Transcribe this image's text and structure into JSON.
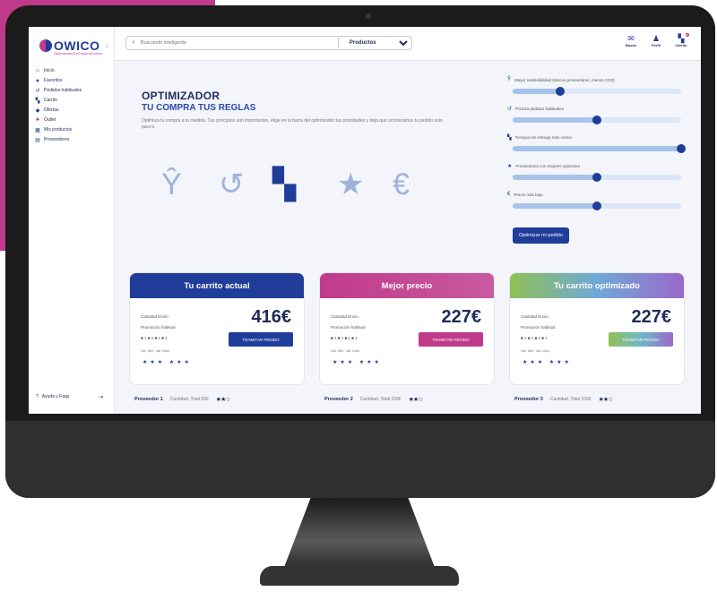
{
  "brand": {
    "name": "OWICO",
    "tagline": "OptimizadorDeComprasOnline",
    "magenta": "#c03a8b",
    "navy": "#1f3d99"
  },
  "sidebar": {
    "items": [
      {
        "label": "Inicio",
        "icon": "home-icon"
      },
      {
        "label": "Favoritos",
        "icon": "star-icon"
      },
      {
        "label": "Pedidos habituales",
        "icon": "history-icon"
      },
      {
        "label": "Carrito",
        "icon": "cart-icon"
      },
      {
        "label": "Ofertas",
        "icon": "tag-icon"
      },
      {
        "label": "Outlet",
        "icon": "outlet-icon"
      },
      {
        "label": "Mis productos",
        "icon": "products-icon"
      },
      {
        "label": "Proveedores",
        "icon": "store-icon"
      }
    ],
    "help": "Ayuda y Faqs"
  },
  "topbar": {
    "search_placeholder": "Buscando inteligente",
    "select_value": "Productos",
    "icons": [
      {
        "label": "Buzón",
        "icon": "mail-icon"
      },
      {
        "label": "Perfil",
        "icon": "user-icon"
      },
      {
        "label": "Carrito",
        "icon": "cart-icon"
      }
    ]
  },
  "hero": {
    "title": "OPTIMIZADOR",
    "subtitle": "TU COMPRA TUS REGLAS",
    "description": "Optimiza tu compra a tu medida. Tus principios son importantes, elige en la barra del optimizador tus prioridades y deja que ocrimicamos tu pedido solo para ti."
  },
  "feature_icons": [
    {
      "icon": "sprout-icon",
      "color": "#9db3dc"
    },
    {
      "icon": "history-icon",
      "color": "#9db3dc"
    },
    {
      "icon": "truck-icon",
      "color": "#1f3d99"
    },
    {
      "icon": "star-icon",
      "color": "#9db3dc"
    },
    {
      "icon": "euro-icon",
      "color": "#9db3dc"
    }
  ],
  "sliders": [
    {
      "label": "Mayor sostenibilidad (Menos proveedores, menos CO2)",
      "icon": "sprout-icon",
      "value": 0.28
    },
    {
      "label": "Prioriza pedidos habituales",
      "icon": "history-icon",
      "value": 0.5
    },
    {
      "label": "Tiempos de entrega más cortos",
      "icon": "truck-icon",
      "value": 1.0
    },
    {
      "label": "Proveedores con mejores opiniones",
      "icon": "star-icon",
      "value": 0.5
    },
    {
      "label": "Precio más bajo",
      "icon": "euro-icon",
      "value": 0.5
    }
  ],
  "optimize_button": "Optimizar mi pedido",
  "cards": [
    {
      "title": "Tu carrito actual",
      "price": "416€",
      "button": "TRAMITAR PEDIDO",
      "header_color": "#1f3d99",
      "button_color": "#1f3d99",
      "r1": "Cantidad Envío",
      "r2": "Promoción habitual",
      "r3": "■ 1 ■ 1 ■ 1 ■ 1",
      "r4": "Val. Mín.    Val. Máx."
    },
    {
      "title": "Mejor precio",
      "price": "227€",
      "button": "TRAMITAR PEDIDO",
      "header_color": "#c03a8b",
      "button_color": "#c03a8b",
      "r1": "Cantidad Envío",
      "r2": "Promoción habitual",
      "r3": "■ 1 ■ 1 ■ 1 ■ 1",
      "r4": "Val. Mín.    Val. Máx."
    },
    {
      "title": "Tu carrito optimizado",
      "price": "227€",
      "button": "TRAMITAR PEDIDO",
      "header_color": "#8fc056",
      "button_color": "#6fb8c8",
      "r1": "Cantidad Envío",
      "r2": "Promoción habitual",
      "r3": "■ 1 ■ 1 ■ 1 ■ 1",
      "r4": "Val. Mín.    Val. Máx."
    }
  ],
  "providers": [
    {
      "name": "Proveedor 1",
      "total": "Cantidad, Total 83€"
    },
    {
      "name": "Proveedor 2",
      "total": "Cantidad, Total 159€"
    },
    {
      "name": "Proveedor 3",
      "total": "Cantidad, Total 159€"
    }
  ]
}
